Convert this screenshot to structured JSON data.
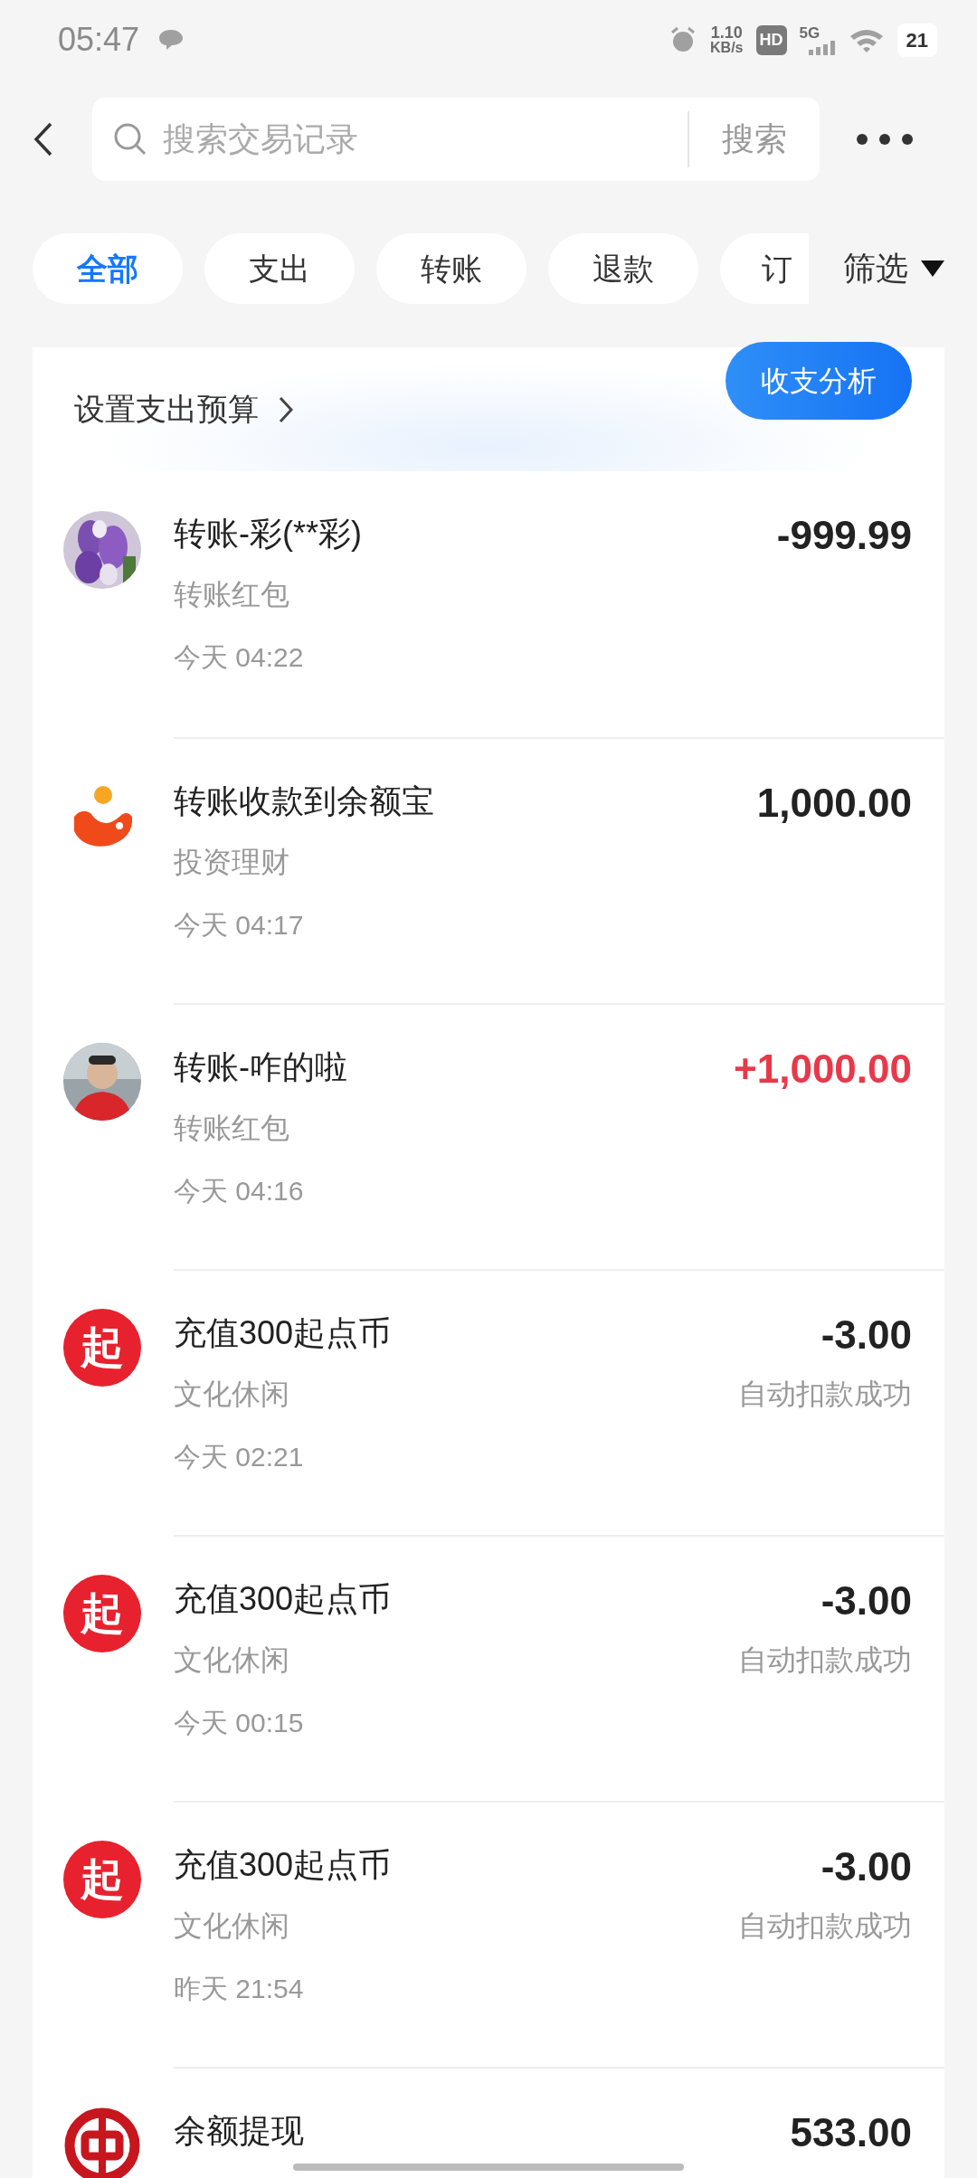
{
  "status_bar": {
    "time": "05:47",
    "speed_value": "1.10",
    "speed_unit": "KB/s",
    "hd": "HD",
    "network": "5G",
    "battery": "21"
  },
  "search": {
    "placeholder": "搜索交易记录",
    "button": "搜索"
  },
  "filters": [
    {
      "label": "全部",
      "selected": true
    },
    {
      "label": "支出",
      "selected": false
    },
    {
      "label": "转账",
      "selected": false
    },
    {
      "label": "退款",
      "selected": false
    },
    {
      "label": "订",
      "selected": false
    }
  ],
  "filter_button": "筛选",
  "budget": {
    "label": "设置支出预算",
    "analysis_button": "收支分析"
  },
  "transactions": [
    {
      "kind": "flowers",
      "title": "转账-彩(**彩)",
      "category": "转账红包",
      "time": "今天 04:22",
      "amount": "-999.99",
      "credit": false
    },
    {
      "kind": "yuebao",
      "title": "转账收款到余额宝",
      "category": "投资理财",
      "time": "今天 04:17",
      "amount": "1,000.00",
      "credit": false
    },
    {
      "kind": "person",
      "title": "转账-咋的啦",
      "category": "转账红包",
      "time": "今天 04:16",
      "amount": "+1,000.00",
      "credit": true
    },
    {
      "kind": "qidian",
      "avatar_text": "起",
      "title": "充值300起点币",
      "category": "文化休闲",
      "time": "今天 02:21",
      "amount": "-3.00",
      "status": "自动扣款成功",
      "credit": false
    },
    {
      "kind": "qidian",
      "avatar_text": "起",
      "title": "充值300起点币",
      "category": "文化休闲",
      "time": "今天 00:15",
      "amount": "-3.00",
      "status": "自动扣款成功",
      "credit": false
    },
    {
      "kind": "qidian",
      "avatar_text": "起",
      "title": "充值300起点币",
      "category": "文化休闲",
      "time": "昨天 21:54",
      "amount": "-3.00",
      "status": "自动扣款成功",
      "credit": false
    },
    {
      "kind": "bank",
      "title": "余额提现",
      "amount": "533.00",
      "credit": false
    }
  ]
}
